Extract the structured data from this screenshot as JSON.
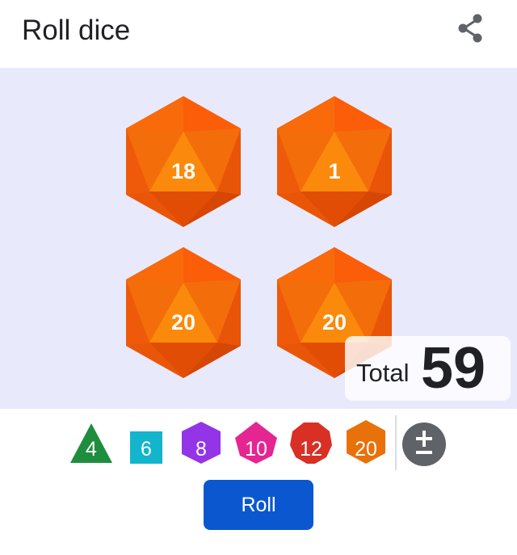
{
  "header": {
    "title": "Roll dice",
    "share_icon": "share-icon"
  },
  "dice": [
    {
      "type": "d20",
      "value": "18"
    },
    {
      "type": "d20",
      "value": "1"
    },
    {
      "type": "d20",
      "value": "20"
    },
    {
      "type": "d20",
      "value": "20"
    }
  ],
  "total": {
    "label": "Total",
    "value": "59"
  },
  "dice_picker": [
    {
      "label": "4",
      "shape": "triangle",
      "color": "#1e8e3e"
    },
    {
      "label": "6",
      "shape": "square",
      "color": "#12b5cb"
    },
    {
      "label": "8",
      "shape": "hexagon",
      "color": "#9334e6"
    },
    {
      "label": "10",
      "shape": "hexagon",
      "color": "#e52592"
    },
    {
      "label": "12",
      "shape": "decagon",
      "color": "#d93025"
    },
    {
      "label": "20",
      "shape": "hexagon",
      "color": "#e8710a"
    }
  ],
  "modifier": {
    "icon": "plus-minus-icon"
  },
  "roll_button": {
    "label": "Roll"
  },
  "colors": {
    "roll_area_bg": "#e8eafb",
    "d20_orange": "#f46d0b",
    "button_blue": "#0b57d0"
  }
}
